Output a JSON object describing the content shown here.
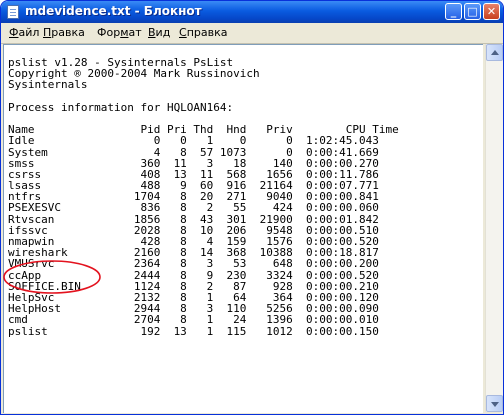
{
  "window": {
    "title": "mdevidence.txt - Блокнот",
    "buttons": {
      "minimize": "_",
      "maximize": "□",
      "close": "✕"
    },
    "icon": "notepad-icon"
  },
  "menu": {
    "file": {
      "hotkey": "Ф",
      "rest": "айл"
    },
    "edit": {
      "hotkey": "П",
      "rest": "равка"
    },
    "format": {
      "pre": "Фор",
      "hotkey": "м",
      "rest": "ат"
    },
    "view": {
      "hotkey": "В",
      "rest": "ид"
    },
    "help": {
      "hotkey": "С",
      "rest": "правка"
    }
  },
  "document": {
    "lines": [
      "pslist v1.28 - Sysinternals PsList",
      "Copyright ® 2000-2004 Mark Russinovich",
      "Sysinternals",
      "",
      "Process information for HQLOAN164:",
      "",
      "Name                Pid Pri Thd  Hnd   Priv        CPU Time",
      "Idle                  0   0   1    0      0  1:02:45.043",
      "System                4   8  57 1073      0  0:00:41.669",
      "smss                360  11   3   18    140  0:00:00.270",
      "csrss               408  13  11  568   1656  0:00:11.786",
      "lsass               488   9  60  916  21164  0:00:07.771",
      "ntfrs              1704   8  20  271   9040  0:00:00.841",
      "PSEXESVC            836   8   2   55    424  0:00:00.060",
      "Rtvscan            1856   8  43  301  21900  0:00:01.842",
      "ifssvc             2028   8  10  206   9548  0:00:00.510",
      "nmapwin             428   8   4  159   1576  0:00:00.520",
      "wireshark          2160   8  14  368  10388  0:00:18.817",
      "VMUSrvc            2364   8   3   53    648  0:00:00.200",
      "ccApp              2444   8   9  230   3324  0:00:00.520",
      "SOFFICE.BIN        1124   8   2   87    928  0:00:00.210",
      "HelpSvc            2132   8   1   64    364  0:00:00.120",
      "HelpHost           2944   8   3  110   5256  0:00:00.090",
      "cmd                2704   8   1   24   1396  0:00:00.010",
      "pslist              192  13   1  115   1012  0:00:00.150"
    ]
  },
  "annotation": {
    "color": "#e3121e",
    "highlights": [
      "nmapwin",
      "wireshark"
    ]
  },
  "colors": {
    "titlebar": "#0a5be0",
    "window_face": "#ece9d8"
  }
}
